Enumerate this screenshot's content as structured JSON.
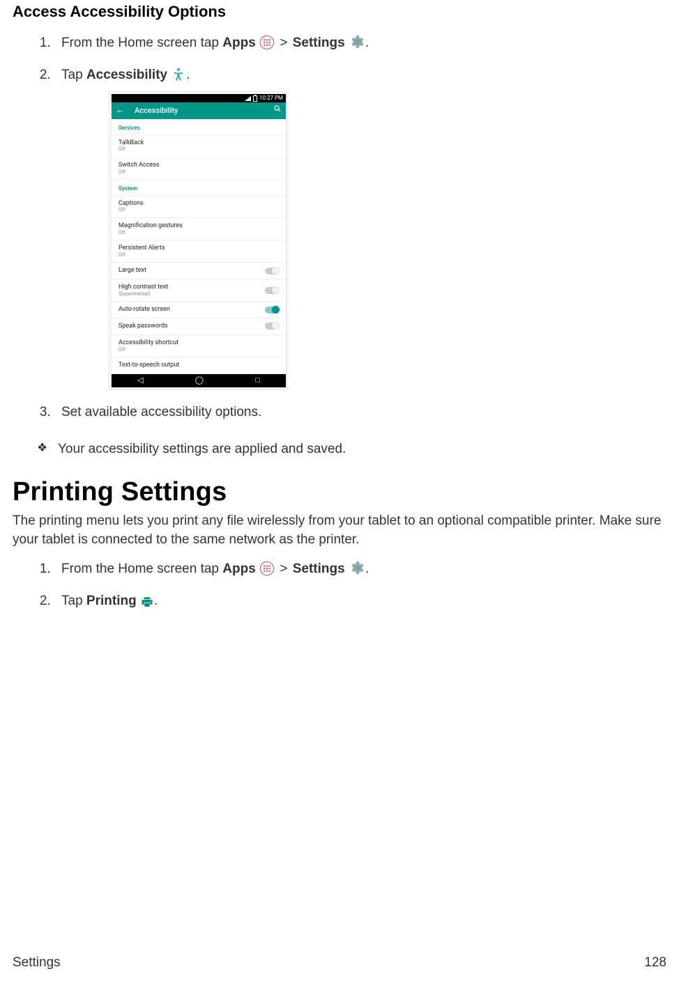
{
  "section1": {
    "heading": "Access Accessibility Options",
    "step1": {
      "prefix": "From the Home screen tap ",
      "apps": "Apps",
      "gt": ">",
      "settings": "Settings",
      "suffix": "."
    },
    "step2": {
      "prefix": "Tap ",
      "strong": "Accessibility",
      "space": " ",
      "suffix": "."
    },
    "step3": "Set available accessibility options.",
    "result": "Your accessibility settings are applied and saved."
  },
  "screenshot": {
    "time": "10:27 PM",
    "appbar_title": "Accessibility",
    "cat_services": "Services",
    "cat_system": "System",
    "rows": {
      "talkback": "TalkBack",
      "switch_access": "Switch Access",
      "captions": "Captions",
      "magnification": "Magnification gestures",
      "persistent": "Persistent Alerts",
      "large_text": "Large text",
      "high_contrast": "High contrast text",
      "high_contrast_sub": "(Experimental)",
      "auto_rotate": "Auto-rotate screen",
      "speak_passwords": "Speak passwords",
      "a11y_shortcut": "Accessibility shortcut",
      "tts": "Text-to-speech output",
      "off": "Off"
    }
  },
  "section2": {
    "heading": "Printing Settings",
    "desc": "The printing menu lets you print any file wirelessly from your tablet to an optional compatible printer. Make sure your tablet is connected to the same network as the printer.",
    "step1": {
      "prefix": "From the Home screen tap ",
      "apps": "Apps",
      "gt": ">",
      "settings": "Settings",
      "suffix": "."
    },
    "step2": {
      "prefix": "Tap ",
      "strong": "Printing",
      "space": " ",
      "suffix": "."
    }
  },
  "footer": {
    "left": "Settings",
    "right": "128"
  }
}
